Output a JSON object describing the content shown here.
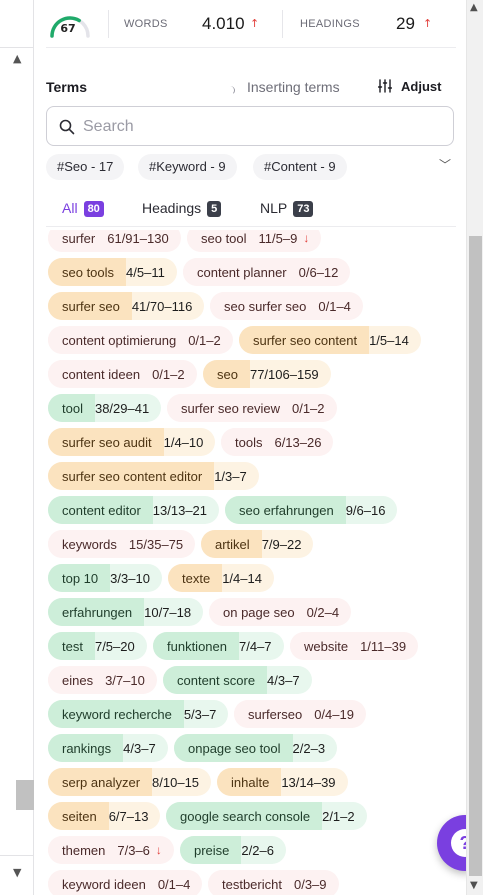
{
  "metrics": {
    "score": "67",
    "score_fraction": 0.67,
    "words_label": "WORDS",
    "words_value": "4.010",
    "headings_label": "HEADINGS",
    "headings_value": "29",
    "up_arrow": "↑"
  },
  "terms": {
    "title": "Terms",
    "inserting_label": "Inserting terms",
    "adjust_label": "Adjust",
    "search_placeholder": "Search"
  },
  "filters": [
    "#Seo - 17",
    "#Keyword - 9",
    "#Content - 9"
  ],
  "tabs": [
    {
      "label": "All",
      "count": "80",
      "active": true
    },
    {
      "label": "Headings",
      "count": "5",
      "active": false
    },
    {
      "label": "NLP",
      "count": "73",
      "active": false
    }
  ],
  "term_rows": [
    [
      {
        "term": "surfer",
        "count": "61/91–130",
        "status": "red"
      },
      {
        "term": "seo tool",
        "count": "11/5–9",
        "status": "red",
        "down": "↓"
      }
    ],
    [
      {
        "term": "seo tools",
        "count": "4/5–11",
        "status": "orange"
      },
      {
        "term": "content planner",
        "count": "0/6–12",
        "status": "red"
      }
    ],
    [
      {
        "term": "surfer seo",
        "count": "41/70–116",
        "status": "orange"
      },
      {
        "term": "seo surfer seo",
        "count": "0/1–4",
        "status": "red"
      }
    ],
    [
      {
        "term": "content optimierung",
        "count": "0/1–2",
        "status": "red"
      },
      {
        "term": "surfer seo content",
        "count": "1/5–14",
        "status": "orange"
      }
    ],
    [
      {
        "term": "content ideen",
        "count": "0/1–2",
        "status": "red"
      },
      {
        "term": "seo",
        "count": "77/106–159",
        "status": "orange"
      }
    ],
    [
      {
        "term": "tool",
        "count": "38/29–41",
        "status": "green"
      },
      {
        "term": "surfer seo review",
        "count": "0/1–2",
        "status": "red"
      }
    ],
    [
      {
        "term": "surfer seo audit",
        "count": "1/4–10",
        "status": "orange"
      },
      {
        "term": "tools",
        "count": "6/13–26",
        "status": "red"
      }
    ],
    [
      {
        "term": "surfer seo content editor",
        "count": "1/3–7",
        "status": "orange"
      }
    ],
    [
      {
        "term": "content editor",
        "count": "13/13–21",
        "status": "green"
      },
      {
        "term": "seo erfahrungen",
        "count": "9/6–16",
        "status": "green"
      }
    ],
    [
      {
        "term": "keywords",
        "count": "15/35–75",
        "status": "red"
      },
      {
        "term": "artikel",
        "count": "7/9–22",
        "status": "orange"
      }
    ],
    [
      {
        "term": "top 10",
        "count": "3/3–10",
        "status": "green"
      },
      {
        "term": "texte",
        "count": "1/4–14",
        "status": "orange"
      }
    ],
    [
      {
        "term": "erfahrungen",
        "count": "10/7–18",
        "status": "green"
      },
      {
        "term": "on page seo",
        "count": "0/2–4",
        "status": "red"
      }
    ],
    [
      {
        "term": "test",
        "count": "7/5–20",
        "status": "green"
      },
      {
        "term": "funktionen",
        "count": "7/4–7",
        "status": "green"
      },
      {
        "term": "website",
        "count": "1/11–39",
        "status": "red"
      }
    ],
    [
      {
        "term": "eines",
        "count": "3/7–10",
        "status": "red"
      },
      {
        "term": "content score",
        "count": "4/3–7",
        "status": "green"
      }
    ],
    [
      {
        "term": "keyword recherche",
        "count": "5/3–7",
        "status": "green"
      },
      {
        "term": "surferseo",
        "count": "0/4–19",
        "status": "red"
      }
    ],
    [
      {
        "term": "rankings",
        "count": "4/3–7",
        "status": "green"
      },
      {
        "term": "onpage seo tool",
        "count": "2/2–3",
        "status": "green"
      }
    ],
    [
      {
        "term": "serp analyzer",
        "count": "8/10–15",
        "status": "orange"
      },
      {
        "term": "inhalte",
        "count": "13/14–39",
        "status": "orange"
      }
    ],
    [
      {
        "term": "seiten",
        "count": "6/7–13",
        "status": "orange"
      },
      {
        "term": "google search console",
        "count": "2/1–2",
        "status": "green"
      }
    ],
    [
      {
        "term": "themen",
        "count": "7/3–6",
        "status": "red",
        "down": "↓"
      },
      {
        "term": "preise",
        "count": "2/2–6",
        "status": "green"
      }
    ],
    [
      {
        "term": "keyword ideen",
        "count": "0/1–4",
        "status": "red"
      },
      {
        "term": "testbericht",
        "count": "0/3–9",
        "status": "red"
      }
    ]
  ],
  "help": {
    "label": "?"
  },
  "colors": {
    "accent": "#7a3fe0",
    "green": "#cdeed9",
    "orange": "#fbe3bf",
    "red": "#fdf2f2",
    "alert": "#e2403c"
  },
  "icons": [
    "gauge-icon",
    "spinner-icon",
    "sliders-icon",
    "search-icon",
    "chevron-down-icon",
    "arrow-up-icon",
    "arrow-down-icon",
    "question-icon"
  ]
}
